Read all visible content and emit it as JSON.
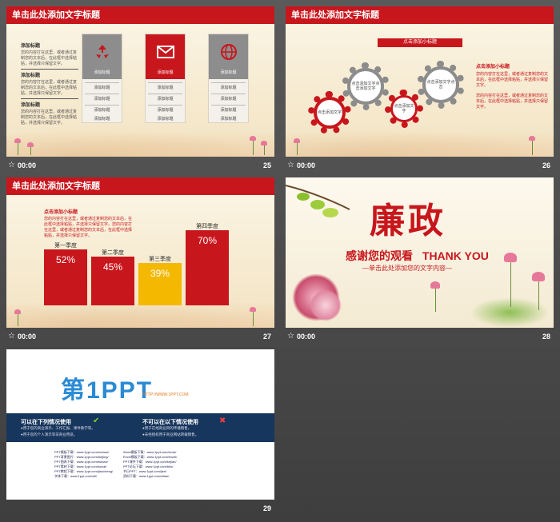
{
  "slides": {
    "s25": {
      "title": "单击此处添加文字标题",
      "left_items": [
        {
          "heading": "添加标题",
          "text": "您的内容打在这里，或者通过复制您的文本后，在此框中选择粘贴，并选择只保留文字。"
        },
        {
          "heading": "添加标题",
          "text": "您的内容打在这里，或者通过复制您的文本后，在此框中选择粘贴，并选择只保留文字。"
        },
        {
          "heading": "添加标题",
          "text": "您的内容打在这里，或者通过复制您的文本后，在此框中选择粘贴，并选择只保留文字。"
        }
      ],
      "cards": [
        {
          "label": "添加标题",
          "rows": [
            "添加标题",
            "添加标题",
            "添加标题",
            "添加标题"
          ]
        },
        {
          "label": "添加标题",
          "rows": [
            "添加标题",
            "添加标题",
            "添加标题",
            "添加标题"
          ]
        },
        {
          "label": "添加标题",
          "rows": [
            "添加标题",
            "添加标题",
            "添加标题",
            "添加标题"
          ]
        }
      ],
      "time": "00:00",
      "number": "25"
    },
    "s26": {
      "title": "单击此处添加文字标题",
      "subtitle": "点击添加小标题",
      "gears": [
        "点击添加文字点击添加文字",
        "点击添加文字点击",
        "点击添加文字",
        "点击添加文字"
      ],
      "right_heading": "点击添加小标题",
      "right_text_1": "您的内容打在这里，或者通过复制您的文本后，在此框中选择粘贴，并选择只保留文字。",
      "right_text_2": "您的内容打在这里，或者通过复制您的文本后，在此框中选择粘贴，并选择只保留文字。",
      "time": "00:00",
      "number": "26"
    },
    "s27": {
      "title": "单击此处添加文字标题",
      "heading": "点击添加小标题",
      "text": "您的内容打在这里，或者通过复制您的文本后，在此框中选择粘贴，并选择只保留文字。您的内容打在这里，或者通过复制您的文本后，在此框中选择粘贴，并选择只保留文字。",
      "time": "00:00",
      "number": "27"
    },
    "s28": {
      "big_title": "廉政",
      "thanks": "感谢您的观看",
      "thank_you": "THANK YOU",
      "subtitle": "—单击此处添加您的文字内容—",
      "time": "00:00",
      "number": "28"
    },
    "s29": {
      "logo_main": "第1PPT",
      "logo_url": "HTTP://WWW.1PPT.COM",
      "can_title": "可以在下列情况使用",
      "can_1": "●用于您的商业演示、工作汇报、课件教学等。",
      "can_2": "●用于您的个人演示等非商业用途。",
      "cannot_title": "不可以在以下情况使用",
      "cannot_1": "●用于在线商业目的传播销售。",
      "cannot_2": "●未经授权用于商业网站转载销售。",
      "links_left": [
        "PPT模板下载：www.1ppt.com/moban/",
        "PPT背景图片：www.1ppt.com/beijing/",
        "PPT图表下载：www.1ppt.com/tubiao/",
        "PPT素材下载：www.1ppt.com/sucai/",
        "PPT教程下载：www.1ppt.com/jiaocheng/",
        "字体下载：www.1ppt.com/ziti/"
      ],
      "links_right": [
        "Word模板下载：www.1ppt.com/word/",
        "Excel模板下载：www.1ppt.com/excel/",
        "PPT课件下载：www.1ppt.com/kejian/",
        "PPT论坛下载：www.1ppt.com/bbs/",
        "节日PPT：www.1ppt.com/jieri/",
        "资料下载：www.1ppt.com/ziliao/"
      ],
      "number": "29"
    }
  },
  "chart_data": {
    "type": "bar",
    "categories": [
      "第一季度",
      "第二季度",
      "第三季度",
      "第四季度"
    ],
    "values": [
      52,
      45,
      39,
      70
    ],
    "value_labels": [
      "52%",
      "45%",
      "39%",
      "70%"
    ],
    "colors": [
      "#c8161d",
      "#c8161d",
      "#f5b800",
      "#c8161d"
    ]
  }
}
